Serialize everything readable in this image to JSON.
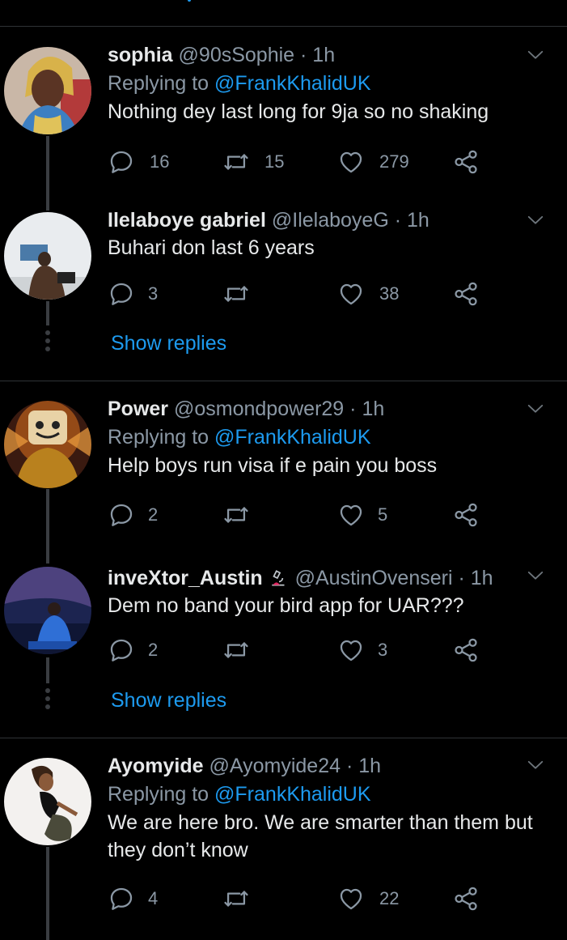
{
  "tweets": [
    {
      "name": "sophia",
      "handle": "@90sSophie",
      "time": "1h",
      "replying_label": "Replying to ",
      "replying_to": "@FrankKhalidUK",
      "text": "Nothing dey last long for 9ja so no shaking",
      "replies": "16",
      "retweets": "15",
      "likes": "279"
    },
    {
      "name": "Ilelaboye gabriel",
      "handle": "@IlelaboyeG",
      "time": "1h",
      "text": "Buhari don last 6 years",
      "replies": "3",
      "retweets": "",
      "likes": "38"
    },
    {
      "name": "Power",
      "handle": "@osmondpower29",
      "time": "1h",
      "replying_label": "Replying to ",
      "replying_to": "@FrankKhalidUK",
      "text": "Help boys run visa if e pain you boss",
      "replies": "2",
      "retweets": "",
      "likes": "5"
    },
    {
      "name": "inveXtor_Austin",
      "handle": "@AustinOvenseri",
      "time": "1h",
      "text": "Dem no band your bird app for UAR???",
      "replies": "2",
      "retweets": "",
      "likes": "3"
    },
    {
      "name": "Ayomyide",
      "handle": "@Ayomyide24",
      "time": "1h",
      "replying_label": "Replying to ",
      "replying_to": "@FrankKhalidUK",
      "text_line1": "We are here bro. We are smarter than them but",
      "text_line2": "they don’t know",
      "replies": "4",
      "retweets": "",
      "likes": "22"
    }
  ],
  "show_replies_label": "Show replies",
  "icons": {
    "reply": "reply-icon",
    "retweet": "retweet-icon",
    "like": "heart-icon",
    "share": "share-icon",
    "menu": "chevron-down-icon",
    "badge": "microscope-icon"
  },
  "colors": {
    "background": "#000000",
    "accent": "#1d9bf0",
    "muted": "#8b98a5",
    "text": "#e7e9ea",
    "divider": "#2f3336"
  }
}
